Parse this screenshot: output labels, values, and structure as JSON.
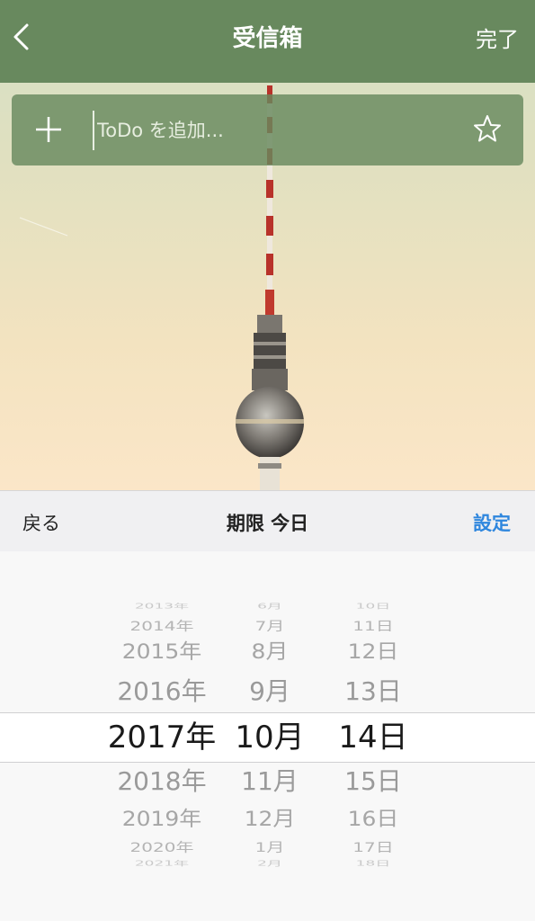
{
  "navbar": {
    "title": "受信箱",
    "done_label": "完了",
    "back_icon": "chevron-left-icon"
  },
  "add_bar": {
    "placeholder": "ToDo を追加...",
    "add_icon": "plus-icon",
    "star_icon": "star-outline-icon"
  },
  "picker_toolbar": {
    "back_label": "戻る",
    "title": "期限 今日",
    "set_label": "設定"
  },
  "date_picker": {
    "years": [
      "2013年",
      "2014年",
      "2015年",
      "2016年",
      "2017年",
      "2018年",
      "2019年",
      "2020年",
      "2021年"
    ],
    "months": [
      "6月",
      "7月",
      "8月",
      "9月",
      "10月",
      "11月",
      "12月",
      "1月",
      "2月"
    ],
    "days": [
      "10日",
      "11日",
      "12日",
      "13日",
      "14日",
      "15日",
      "16日",
      "17日",
      "18日"
    ],
    "selected": {
      "year": "2017年",
      "month": "10月",
      "day": "14日"
    }
  },
  "colors": {
    "navbar_bg": "#68895e",
    "accent": "#2e86de"
  }
}
